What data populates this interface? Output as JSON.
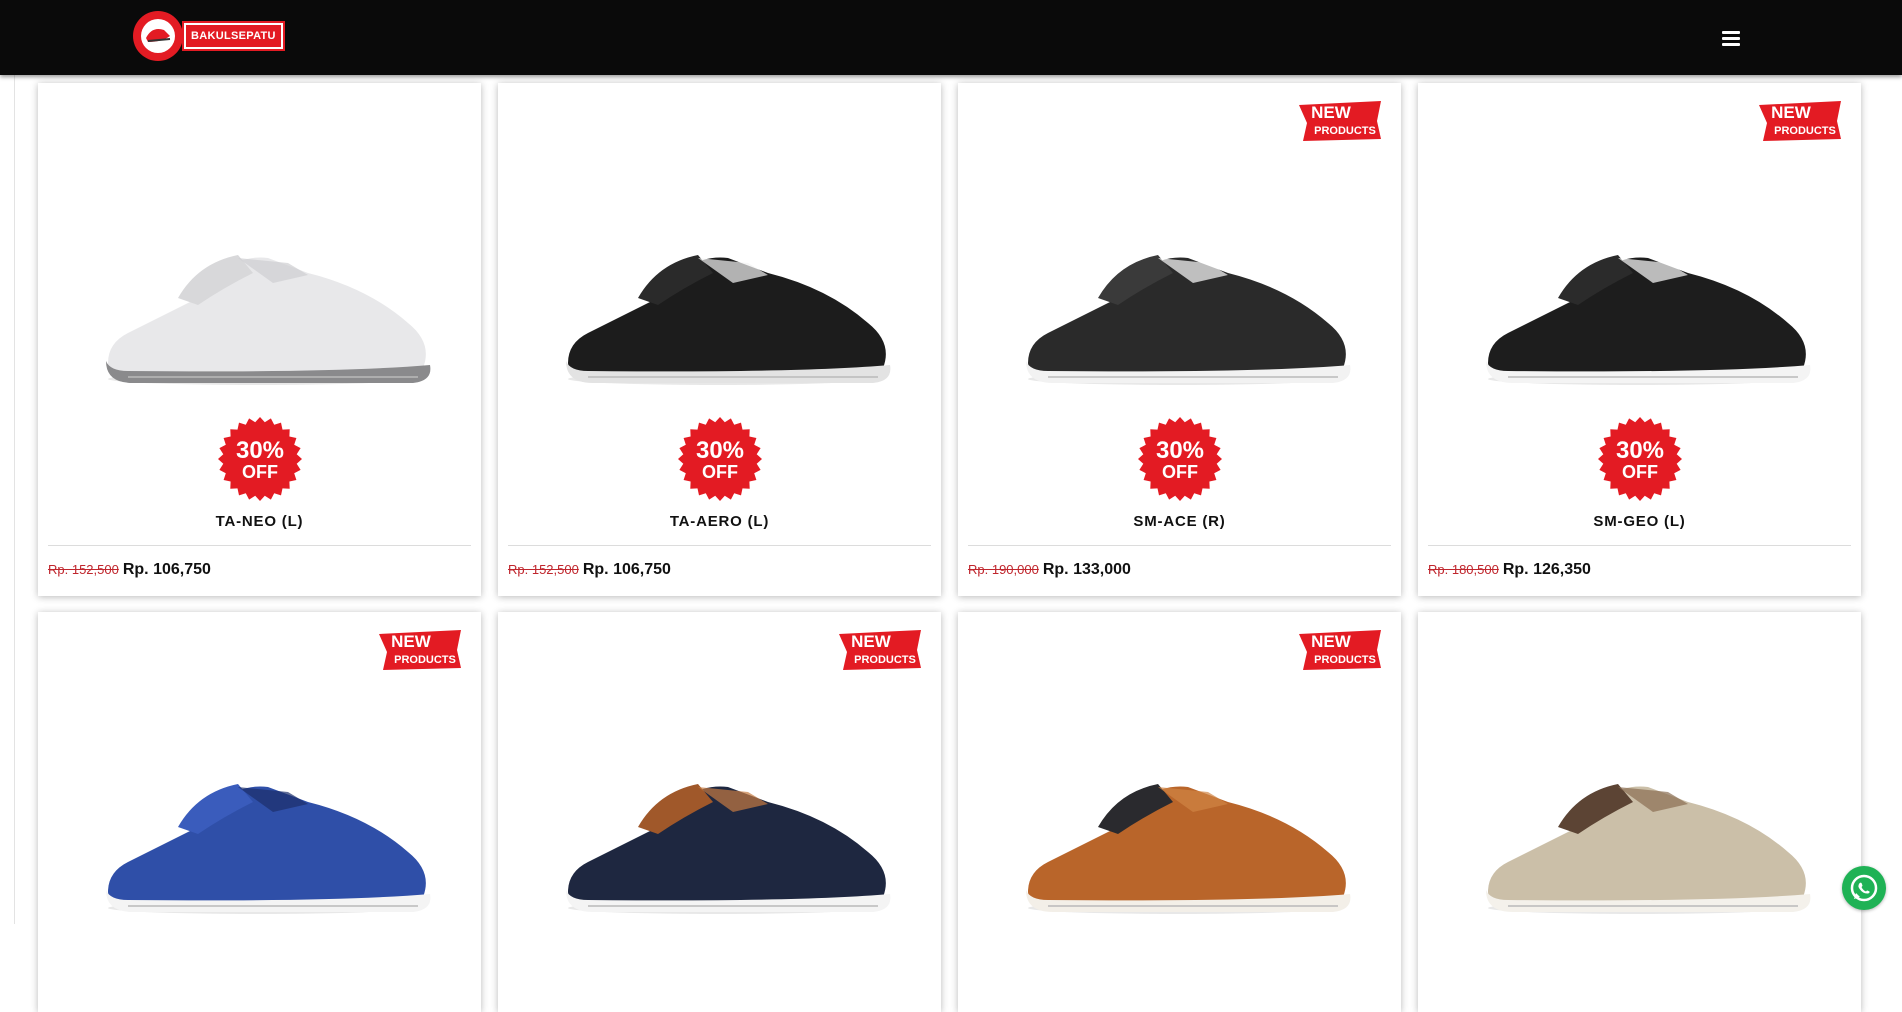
{
  "header": {
    "logo_text": "BAKULSEPATU",
    "logo_ring_text": "BAKUL SEPATU"
  },
  "badges": {
    "new_line1": "NEW",
    "new_line2": "PRODUCTS",
    "off_line1": "30%",
    "off_line2": "OFF"
  },
  "colors": {
    "header_bg": "#0a0a0a",
    "brand_red": "#e31b23",
    "whatsapp_green": "#1fb255"
  },
  "products": [
    {
      "name": "TA-NEO (L)",
      "old_price": "Rp. 152,500",
      "price": "Rp. 106,750",
      "is_new": false,
      "discount": true,
      "shoe_color": "white"
    },
    {
      "name": "TA-AERO (L)",
      "old_price": "Rp. 152,500",
      "price": "Rp. 106,750",
      "is_new": false,
      "discount": true,
      "shoe_color": "black"
    },
    {
      "name": "SM-ACE (R)",
      "old_price": "Rp. 190,000",
      "price": "Rp. 133,000",
      "is_new": true,
      "discount": true,
      "shoe_color": "black-striped"
    },
    {
      "name": "SM-GEO (L)",
      "old_price": "Rp. 180,500",
      "price": "Rp. 126,350",
      "is_new": true,
      "discount": true,
      "shoe_color": "black-white"
    },
    {
      "name": "",
      "old_price": "",
      "price": "",
      "is_new": true,
      "discount": false,
      "shoe_color": "blue"
    },
    {
      "name": "",
      "old_price": "",
      "price": "",
      "is_new": true,
      "discount": false,
      "shoe_color": "navy-brown"
    },
    {
      "name": "",
      "old_price": "",
      "price": "",
      "is_new": true,
      "discount": false,
      "shoe_color": "tan-black"
    },
    {
      "name": "",
      "old_price": "",
      "price": "",
      "is_new": false,
      "discount": false,
      "shoe_color": "beige-brown"
    }
  ],
  "floating": {
    "whatsapp_icon": "whatsapp-icon"
  }
}
